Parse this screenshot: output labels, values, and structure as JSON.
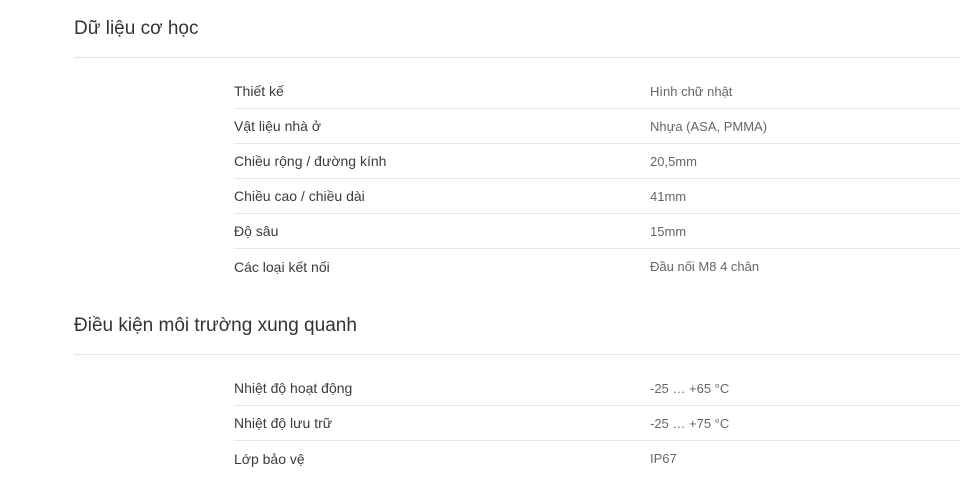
{
  "sections": [
    {
      "title": "Dữ liệu cơ học",
      "rows": [
        {
          "label": "Thiết kế",
          "value": "Hình chữ nhật"
        },
        {
          "label": "Vật liệu nhà ở",
          "value": "Nhựa (ASA, PMMA)"
        },
        {
          "label": "Chiều rộng / đường kính",
          "value": "20,5mm"
        },
        {
          "label": "Chiều cao / chiều dài",
          "value": "41mm"
        },
        {
          "label": "Độ sâu",
          "value": "15mm"
        },
        {
          "label": "Các loại kết nối",
          "value": "Đầu nối M8 4 chân"
        }
      ]
    },
    {
      "title": "Điều kiện môi trường xung quanh",
      "rows": [
        {
          "label": "Nhiệt độ hoạt động",
          "value": "-25 … +65 °C"
        },
        {
          "label": "Nhiệt độ lưu trữ",
          "value": "-25 … +75 °C"
        },
        {
          "label": "Lớp bảo vệ",
          "value": "IP67"
        }
      ]
    }
  ]
}
